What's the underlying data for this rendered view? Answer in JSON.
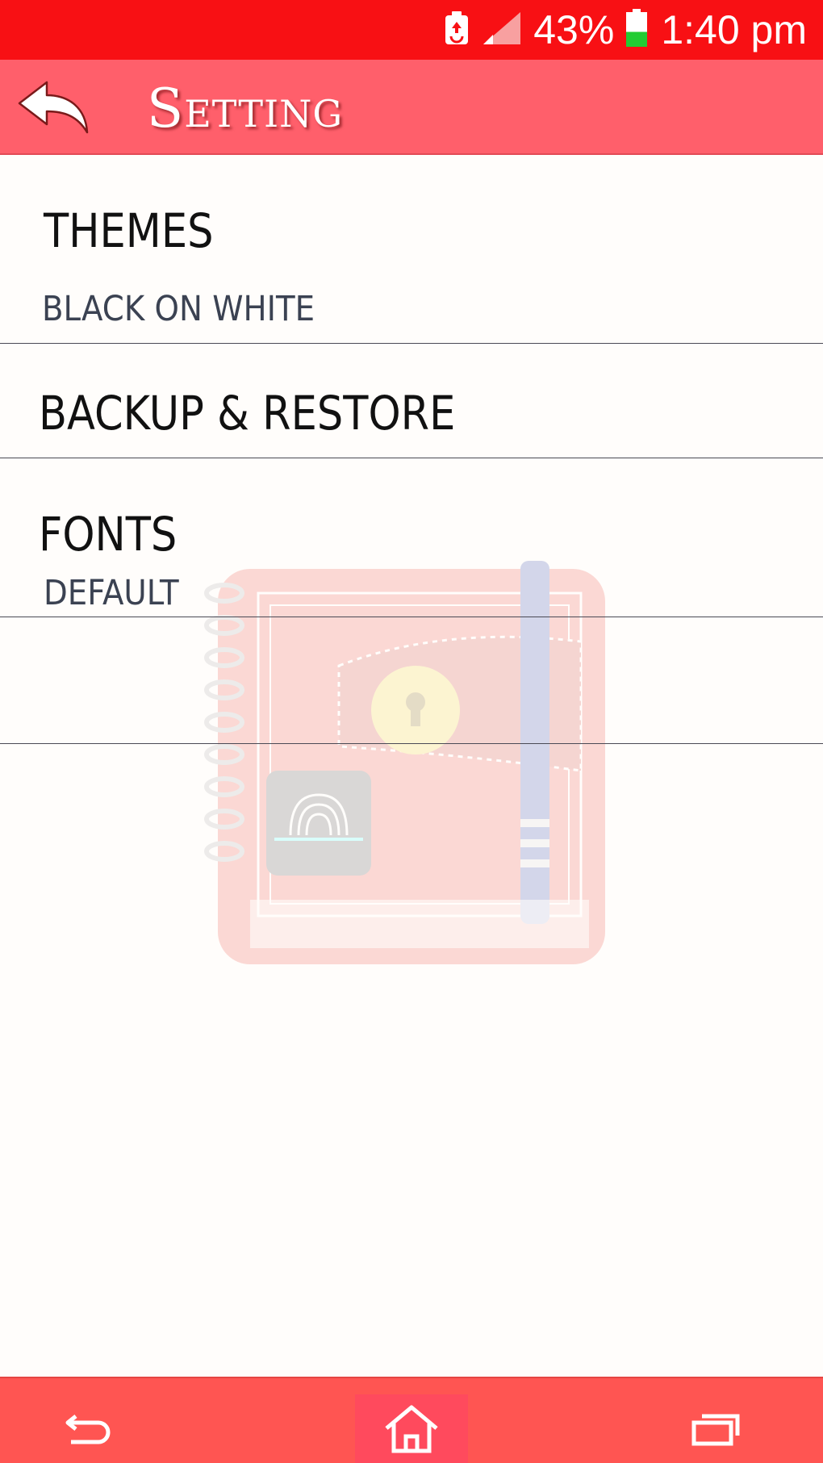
{
  "status_bar": {
    "battery_percent": "43%",
    "time": "1:40 pm",
    "battery_level": 0.43,
    "icons": [
      "battery-saver-icon",
      "signal-icon",
      "battery-icon"
    ]
  },
  "app_bar": {
    "title": "Setting",
    "back_icon": "back-arrow-icon"
  },
  "settings": {
    "themes": {
      "title": "THEMES",
      "value": "BLACK ON WHITE"
    },
    "backup": {
      "title": "BACKUP & RESTORE"
    },
    "fonts": {
      "title": "FONTS",
      "value": "DEFAULT"
    }
  },
  "nav_bar": {
    "icons": [
      "nav-back-icon",
      "home-icon",
      "recent-apps-icon"
    ]
  },
  "colors": {
    "status_bar": "#f81014",
    "app_bar": "#ff5f6b",
    "nav_bar": "#ff5552",
    "text_primary": "#111111",
    "text_secondary": "#3b4252",
    "battery_fill": "#22cc33"
  }
}
